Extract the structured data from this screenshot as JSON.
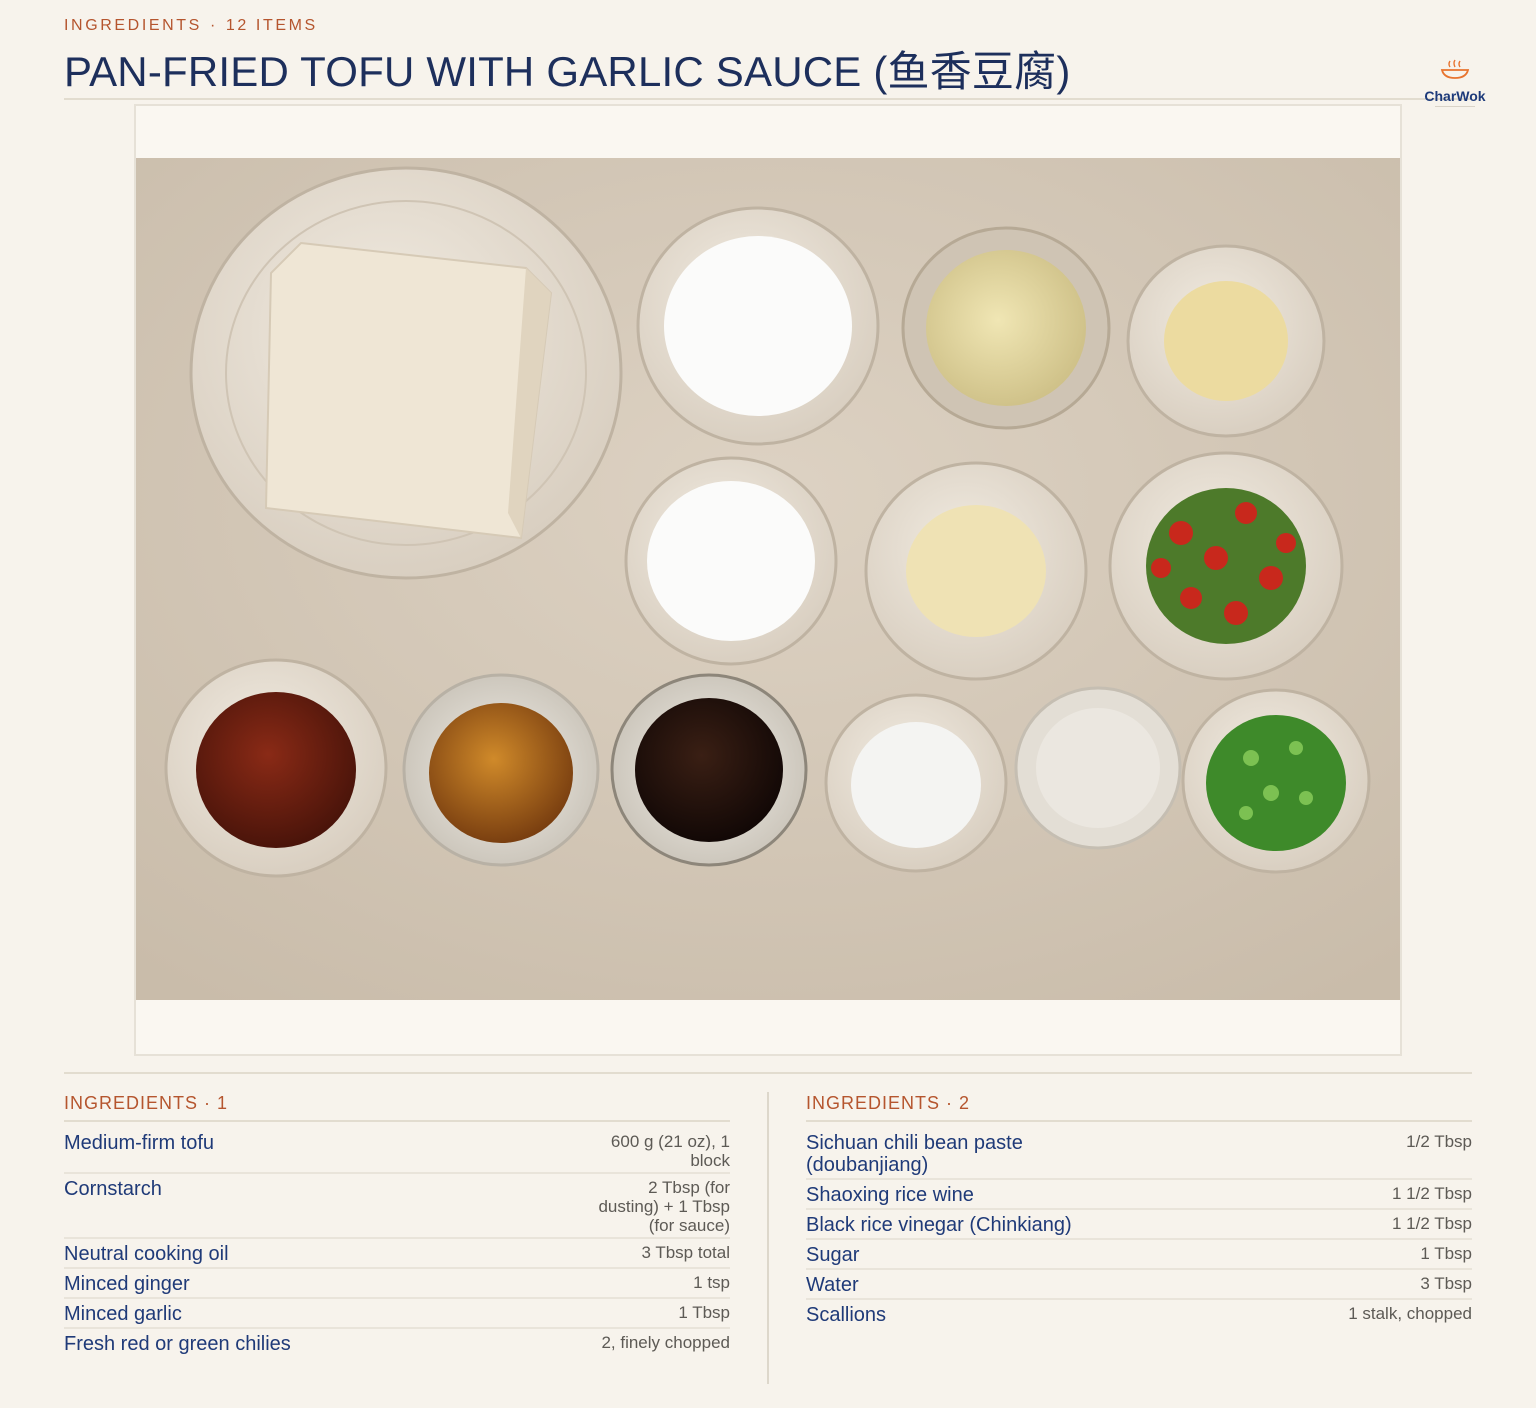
{
  "header": {
    "eyebrow_label": "INGREDIENTS",
    "eyebrow_dot": "·",
    "eyebrow_count": "12 ITEMS",
    "title": "PAN-FRIED TOFU WITH GARLIC SAUCE (鱼香豆腐)"
  },
  "brand": {
    "name": "CharWok",
    "logo_icon": "steaming-wok-icon",
    "accent": "#e8742f"
  },
  "photo": {
    "icon": "ingredients-flatlay-photo"
  },
  "colors": {
    "accent": "#b5552e",
    "heading": "#1d2f5c",
    "item_text": "#1f3a78",
    "background": "#f7f3ec"
  },
  "columns": [
    {
      "label": "INGREDIENTS",
      "dot": "·",
      "number": "1",
      "items": [
        {
          "name": "Medium-firm tofu",
          "qty_lines": [
            "600 g (21 oz), 1",
            "block"
          ]
        },
        {
          "name": "Cornstarch",
          "qty_lines": [
            "2 Tbsp (for",
            "dusting) + 1 Tbsp",
            "(for sauce)"
          ]
        },
        {
          "name": "Neutral cooking oil",
          "qty_lines": [
            "3 Tbsp total"
          ]
        },
        {
          "name": "Minced ginger",
          "qty_lines": [
            "1 tsp"
          ]
        },
        {
          "name": "Minced garlic",
          "qty_lines": [
            "1 Tbsp"
          ]
        },
        {
          "name": "Fresh red or green chilies",
          "qty_lines": [
            "2, finely chopped"
          ]
        }
      ]
    },
    {
      "label": "INGREDIENTS",
      "dot": "·",
      "number": "2",
      "items": [
        {
          "name_lines": [
            "Sichuan chili bean paste",
            "(doubanjiang)"
          ],
          "qty_lines": [
            "1/2 Tbsp"
          ]
        },
        {
          "name": "Shaoxing rice wine",
          "qty_lines": [
            "1 1/2 Tbsp"
          ]
        },
        {
          "name": "Black rice vinegar (Chinkiang)",
          "qty_lines": [
            "1 1/2 Tbsp"
          ]
        },
        {
          "name": "Sugar",
          "qty_lines": [
            "1 Tbsp"
          ]
        },
        {
          "name": "Water",
          "qty_lines": [
            "3 Tbsp"
          ]
        },
        {
          "name": "Scallions",
          "qty_lines": [
            "1 stalk, chopped"
          ]
        }
      ]
    }
  ]
}
